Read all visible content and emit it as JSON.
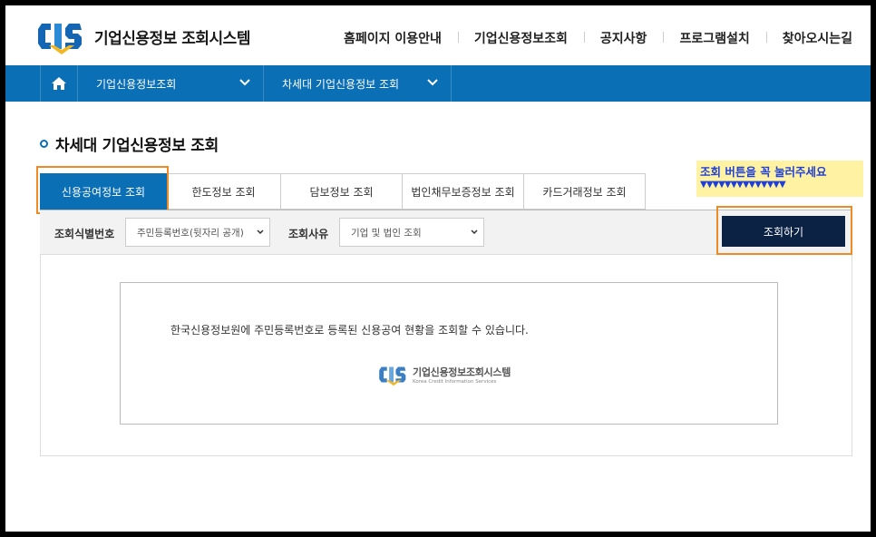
{
  "header": {
    "logo_text": "기업신용정보 조회시스템",
    "nav": [
      "홈페이지 이용안내",
      "기업신용정보조회",
      "공지사항",
      "프로그램설치",
      "찾아오시는길"
    ]
  },
  "navbar": {
    "select1": "기업신용정보조회",
    "select2": "차세대 기업신용정보 조회"
  },
  "page": {
    "title": "차세대 기업신용정보 조회"
  },
  "notice": {
    "line1": "조회 버튼을 꼭 눌러주세요",
    "line2": "▼▼▼▼▼▼▼▼▼▼▼▼▼▼"
  },
  "tabs": [
    {
      "label": "신용공여정보 조회",
      "active": true
    },
    {
      "label": "한도정보 조회",
      "active": false
    },
    {
      "label": "담보정보 조회",
      "active": false
    },
    {
      "label": "법인채무보증정보 조회",
      "active": false
    },
    {
      "label": "카드거래정보 조회",
      "active": false
    }
  ],
  "search": {
    "id_label": "조회식별번호",
    "id_value": "주민등록번호(뒷자리 공개)",
    "reason_label": "조회사유",
    "reason_value": "기업 및 법인 조회",
    "button": "조회하기"
  },
  "content": {
    "description": "한국신용정보원에 주민등록번호로 등록된 신용공여 현황을 조회할 수 있습니다.",
    "logo_title": "기업신용정보조회시스템",
    "logo_sub": "Korea Credit Information Services"
  },
  "colors": {
    "brand_blue": "#0b6fb6",
    "button_navy": "#0c2244",
    "highlight_orange": "#f08a24",
    "notice_yellow": "#fff3a3"
  }
}
